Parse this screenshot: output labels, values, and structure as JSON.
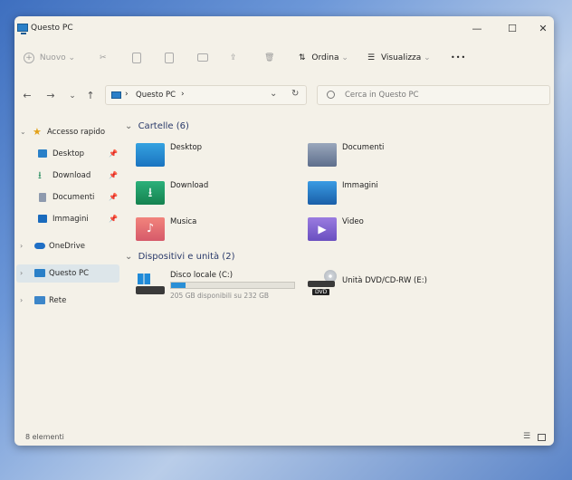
{
  "window": {
    "title": "Questo PC"
  },
  "titlebar": {
    "minimize": "—",
    "maximize": "☐",
    "close": "✕"
  },
  "toolbar": {
    "new_label": "Nuovo",
    "sort_label": "Ordina",
    "view_label": "Visualizza",
    "more_label": "•••"
  },
  "address": {
    "path_separator": "›",
    "location": "Questo PC",
    "search_placeholder": "Cerca in Questo PC"
  },
  "sidebar": {
    "quick_access": "Accesso rapido",
    "pinned": [
      "Desktop",
      "Download",
      "Documenti",
      "Immagini"
    ],
    "onedrive": "OneDrive",
    "this_pc": "Questo PC",
    "network": "Rete"
  },
  "content": {
    "folders_header": "Cartelle (6)",
    "folders": [
      "Desktop",
      "Documenti",
      "Download",
      "Immagini",
      "Musica",
      "Video"
    ],
    "devices_header": "Dispositivi e unità (2)",
    "drives": [
      {
        "name": "Disco locale (C:)",
        "detail": "205 GB disponibili su 232 GB",
        "used_fraction": 0.116
      },
      {
        "name": "Unità DVD/CD-RW (E:)",
        "badge": "DVD"
      }
    ]
  },
  "statusbar": {
    "count": "8 elementi"
  },
  "colors": {
    "accent": "#2a8fd6",
    "window_bg": "#f4f1e8",
    "selected_bg": "#dde6ea"
  }
}
